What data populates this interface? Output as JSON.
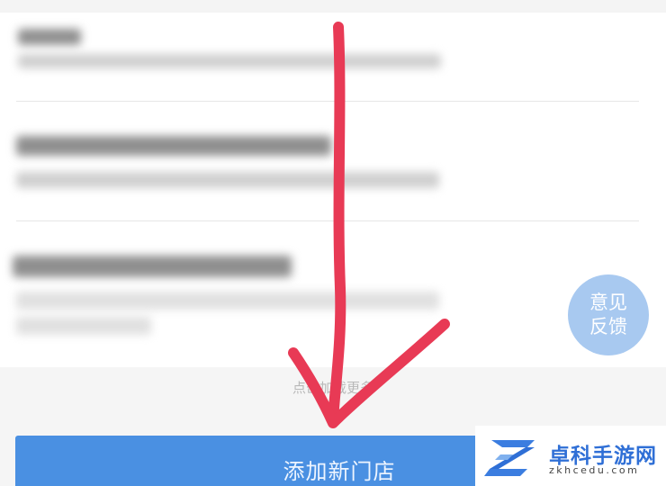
{
  "feedback": {
    "line1": "意见",
    "line2": "反馈"
  },
  "load_more": {
    "label": "点击加载更多"
  },
  "add_store": {
    "label": "添加新门店"
  },
  "watermark": {
    "title": "卓科手游网",
    "domain": "zkhcedu.com"
  },
  "colors": {
    "button_blue": "#4a90e2",
    "feedback_blue": "#a8c9f0",
    "arrow_red": "#e83a55",
    "watermark_blue": "#2f6fd6"
  }
}
